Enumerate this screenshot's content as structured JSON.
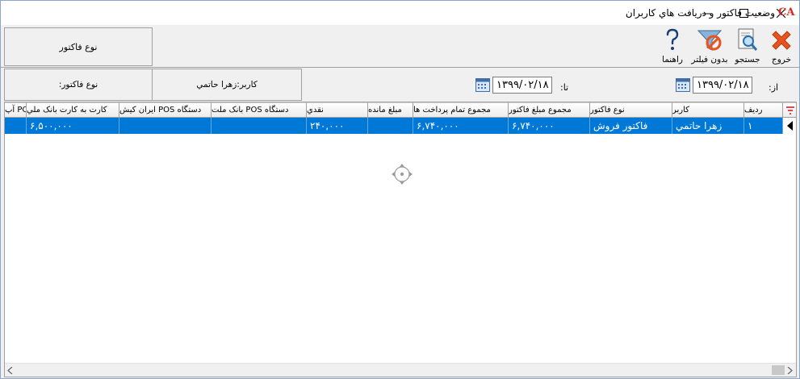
{
  "window": {
    "title": "وضعيت فاکتور و دريافت هاي کاربران",
    "logo_text": "CA"
  },
  "toolbar": {
    "exit_label": "خروج",
    "search_label": "جستجو",
    "nofilter_label": "بدون فيلتر",
    "help_label": "راهنما",
    "invoice_type_panel": "نوع فاکتور"
  },
  "filters": {
    "from_label": "از:",
    "from_date": "۱۳۹۹/۰۲/۱۸",
    "to_label": "تا:",
    "to_date": "۱۳۹۹/۰۲/۱۸",
    "user_text": "كاربر:زهرا حاتمي",
    "invoice_type_text": "نوع فاکتور:"
  },
  "grid": {
    "columns": [
      "رديف",
      "کاربر",
      "نوع فاکتور",
      "مجموع مبلغ فاکتور",
      "مجموع تمام پرداخت ها",
      "مبلغ مانده",
      "نقدي",
      "دستگاه POS بانک ملت",
      "دستگاه POS ايران کيش",
      "کارت به کارت بانک ملي",
      "POS آپ"
    ],
    "rows": [
      {
        "row_no": "۱",
        "user": "زهرا حاتمي",
        "invoice_type": "فاکتور فروش",
        "invoice_total": "۶,۷۴۰,۰۰۰",
        "payments_total": "۶,۷۴۰,۰۰۰",
        "remaining": "",
        "cash": "۲۴۰,۰۰۰",
        "pos_mellat": "",
        "pos_irankish": "",
        "card_melli": "۶,۵۰۰,۰۰۰",
        "pos_ap": ""
      }
    ]
  },
  "colors": {
    "selected_row": "#0078d7",
    "exit_icon": "#e8541e",
    "logo": "#d9281f"
  }
}
